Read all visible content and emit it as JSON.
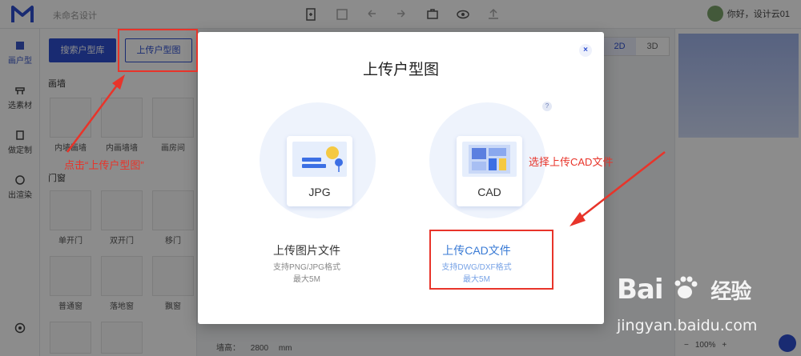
{
  "app": {
    "project_name": "未命名设计",
    "user_greeting": "你好，设计云01"
  },
  "leftnav": {
    "items": [
      {
        "label": "画户型",
        "icon": "floorplan-icon"
      },
      {
        "label": "选素材",
        "icon": "material-icon"
      },
      {
        "label": "做定制",
        "icon": "custom-icon"
      },
      {
        "label": "出渲染",
        "icon": "render-icon"
      }
    ]
  },
  "panel": {
    "search_library_label": "搜索户型库",
    "upload_plan_label": "上传户型图",
    "wall_section": "画墙",
    "wall_items": [
      "内墙画墙",
      "内画墙墙",
      "画房间"
    ],
    "door_section": "门窗",
    "door_items": [
      "单开门",
      "双开门",
      "移门"
    ],
    "window_items": [
      "普通窗",
      "落地窗",
      "飘窗"
    ]
  },
  "canvas": {
    "view_2d": "2D",
    "view_3d": "3D",
    "wall_height_label": "墙高：",
    "wall_height_value": "2800",
    "wall_height_unit": "mm",
    "zoom_value": "100%"
  },
  "modal": {
    "title": "上传户型图",
    "close_symbol": "×",
    "help_symbol": "?",
    "options": {
      "image": {
        "card_label": "JPG",
        "title": "上传图片文件",
        "sub1": "支持PNG/JPG格式",
        "sub2": "最大5M"
      },
      "cad": {
        "card_label": "CAD",
        "title": "上传CAD文件",
        "sub1": "支持DWG/DXF格式",
        "sub2": "最大5M"
      }
    }
  },
  "annotations": {
    "click_upload": "点击“上传户型图”",
    "choose_cad": "选择上传CAD文件",
    "color": "#e8342a"
  },
  "watermark": {
    "brand": "Bai",
    "brand_cn": "经验",
    "url": "jingyan.baidu.com"
  },
  "colors": {
    "primary": "#2f4fd0",
    "link": "#3a7bd5"
  }
}
